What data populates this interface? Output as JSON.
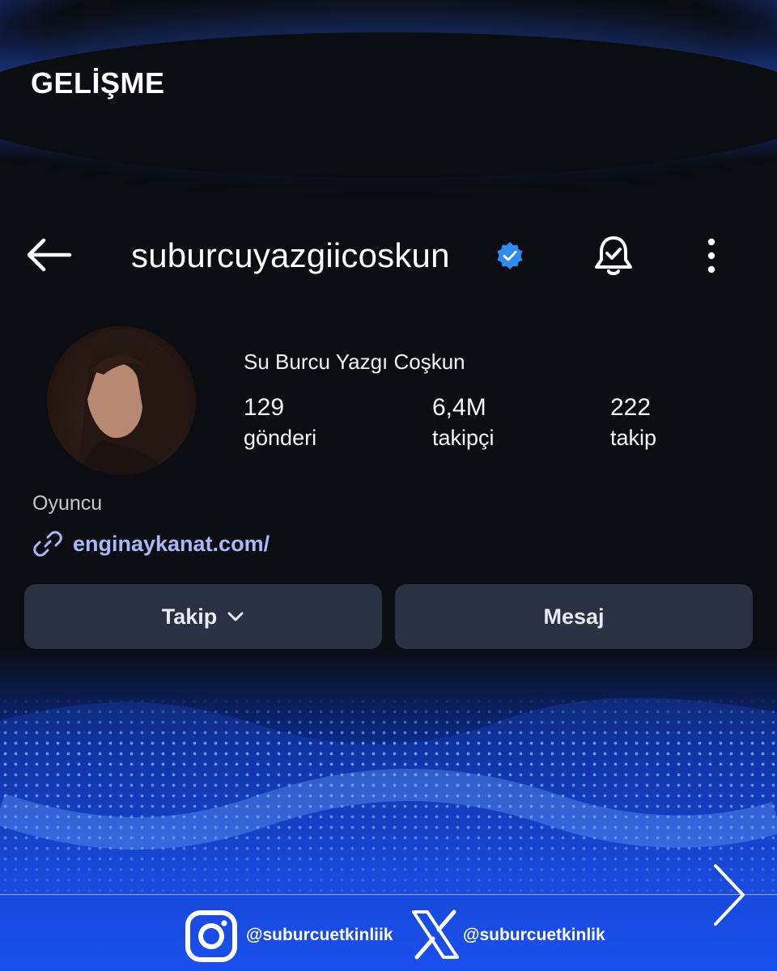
{
  "brand": {
    "title": "GELİŞME"
  },
  "profile": {
    "username": "suburcuyazgiicoskun",
    "verified": true,
    "display_name": "Su Burcu Yazgı Coşkun",
    "stats": [
      {
        "value": "129",
        "label": "gönderi"
      },
      {
        "value": "6,4M",
        "label": "takipçi"
      },
      {
        "value": "222",
        "label": "takip"
      }
    ],
    "bio": "Oyuncu",
    "link": "enginaykanat.com/"
  },
  "actions": {
    "follow_label": "Takip",
    "message_label": "Mesaj"
  },
  "footer": {
    "instagram_handle": "@suburcuetkinliik",
    "x_handle": "@suburcuetkinlik"
  },
  "icons": {
    "back": "back-arrow-icon",
    "verified": "verified-badge-icon",
    "bell": "notification-bell-icon",
    "more": "more-vertical-icon",
    "link": "link-icon",
    "chevron": "chevron-down-icon",
    "next": "chevron-right-icon",
    "instagram": "instagram-icon",
    "x": "x-logo-icon"
  },
  "colors": {
    "background": "#0b0d12",
    "accent_blue": "#1a50ee",
    "verified_blue": "#2d8cf0",
    "link_color": "#a8b8f8",
    "button_bg": "#2a3142"
  }
}
